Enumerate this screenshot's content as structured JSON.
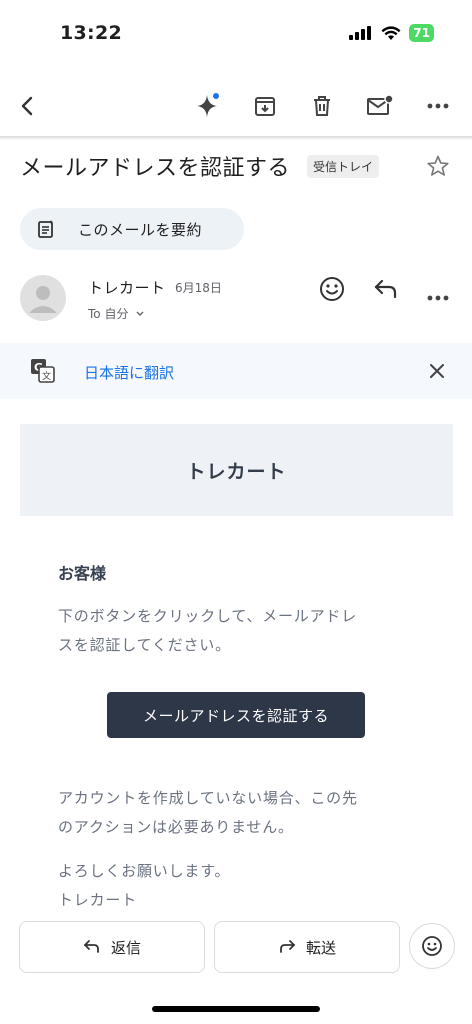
{
  "status_bar": {
    "time": "13:22",
    "battery": "71"
  },
  "subject": {
    "title": "メールアドレスを認証する",
    "label": "受信トレイ"
  },
  "summary_button": {
    "label": "このメールを要約"
  },
  "sender": {
    "name": "トレカート",
    "date": "6月18日",
    "to": "To 自分"
  },
  "translate": {
    "label": "日本語に翻訳"
  },
  "email": {
    "header_title": "トレカート",
    "greeting": "お客様",
    "paragraph1_line1": "下のボタンをクリックして、メールアドレ",
    "paragraph1_line2": "スを認証してください。",
    "verify_button": "メールアドレスを認証する",
    "paragraph2_line1": "アカウントを作成していない場合、この先",
    "paragraph2_line2": "のアクションは必要ありません。",
    "closing": "よろしくお願いします。",
    "signature": "トレカート"
  },
  "footer": {
    "reply": "返信",
    "forward": "転送"
  },
  "colors": {
    "translate_link": "#1a73e8",
    "verify_button_bg": "#2d3748",
    "header_bg": "#eef1f5",
    "battery": "#4cd964"
  },
  "icons": [
    "back-icon",
    "gemini-sparkle-icon",
    "archive-icon",
    "trash-icon",
    "mark-unread-icon",
    "more-icon",
    "star-icon",
    "summary-icon",
    "avatar-icon",
    "emoji-icon",
    "reply-icon",
    "translate-icon",
    "close-icon",
    "forward-icon"
  ]
}
